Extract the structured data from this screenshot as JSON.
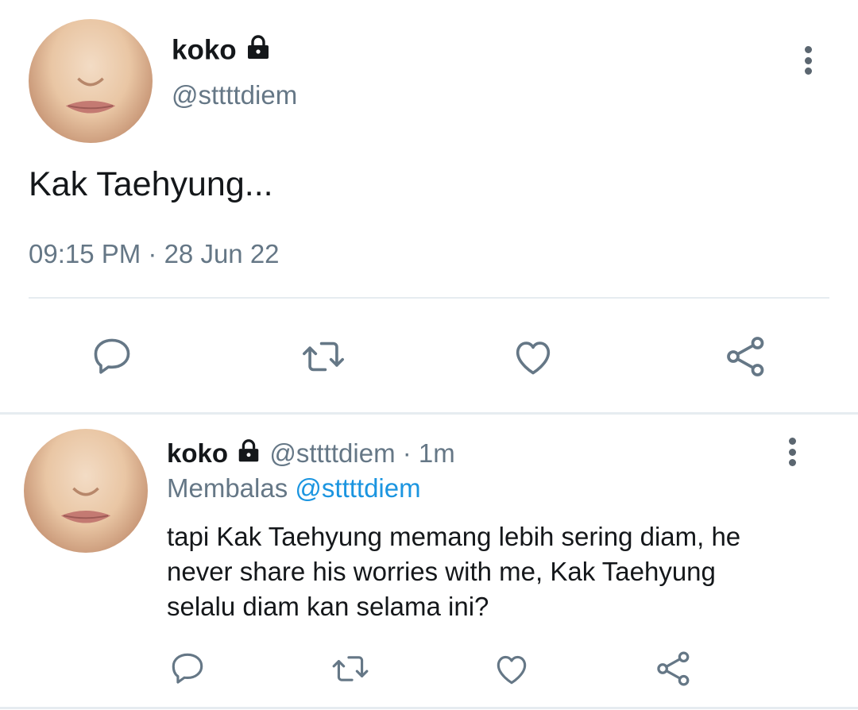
{
  "tweet": {
    "display_name": "koko",
    "handle": "@sttttdiem",
    "text": "Kak Taehyung...",
    "timestamp": "09:15 PM · 28 Jun 22",
    "icons": {
      "lock": "lock-icon",
      "menu": "more-vertical-icon"
    }
  },
  "actions": {
    "reply": "reply-icon",
    "retweet": "retweet-icon",
    "like": "heart-icon",
    "share": "share-icon",
    "color": "#657786"
  },
  "reply_tweet": {
    "display_name": "koko",
    "handle": "@sttttdiem",
    "separator": "·",
    "time_ago": "1m",
    "replying_label": "Membalas",
    "replying_to": "@sttttdiem",
    "text_lines": [
      "tapi Kak Taehyung memang lebih sering diam, he",
      "never share his worries with me, Kak Taehyung",
      "selalu diam kan selama ini?"
    ]
  },
  "colors": {
    "link": "#1b95e0",
    "muted": "#657786",
    "divider": "#e6ecf0"
  }
}
